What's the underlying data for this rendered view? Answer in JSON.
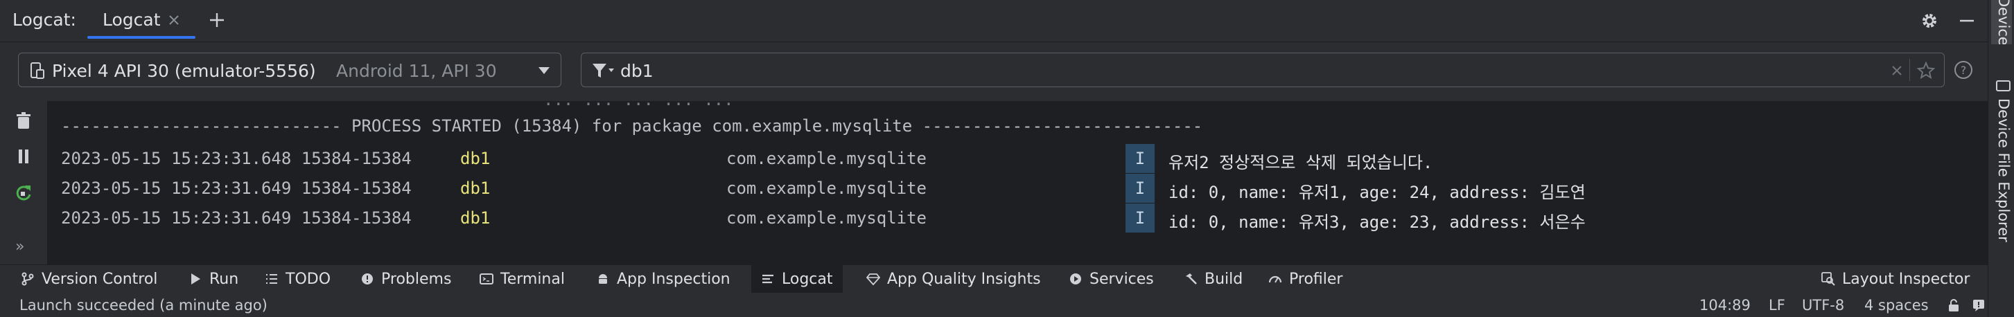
{
  "header": {
    "title": "Logcat:",
    "tab_label": "Logcat"
  },
  "right_strip": {
    "devices_label": "Devices",
    "device_file_explorer_label": "Device File Explorer"
  },
  "toolbar": {
    "device_name": "Pixel 4 API 30 (emulator-5556)",
    "device_api": "Android 11, API 30",
    "filter_value": "db1"
  },
  "log": {
    "fragment": "... ... ... ... ...",
    "process_line": "---------------------------- PROCESS STARTED (15384) for package com.example.mysqlite ----------------------------",
    "rows": [
      {
        "timestamp": "2023-05-15 15:23:31.648 15384-15384",
        "tag": "db1",
        "package": "com.example.mysqlite",
        "level": "I",
        "message": "유저2 정상적으로 삭제 되었습니다."
      },
      {
        "timestamp": "2023-05-15 15:23:31.649 15384-15384",
        "tag": "db1",
        "package": "com.example.mysqlite",
        "level": "I",
        "message": "id: 0, name: 유저1, age: 24, address: 김도연"
      },
      {
        "timestamp": "2023-05-15 15:23:31.649 15384-15384",
        "tag": "db1",
        "package": "com.example.mysqlite",
        "level": "I",
        "message": "id: 0, name: 유저3, age: 23, address: 서은수"
      }
    ]
  },
  "bottom_tabs": {
    "version_control": "Version Control",
    "run": "Run",
    "todo": "TODO",
    "problems": "Problems",
    "terminal": "Terminal",
    "app_inspection": "App Inspection",
    "logcat": "Logcat",
    "app_quality": "App Quality Insights",
    "services": "Services",
    "build": "Build",
    "profiler": "Profiler",
    "layout_inspector": "Layout Inspector"
  },
  "status": {
    "message": "Launch succeeded (a minute ago)",
    "position": "104:89",
    "line_sep": "LF",
    "encoding": "UTF-8",
    "indent": "4 spaces"
  },
  "colors": {
    "accent": "#3574f0",
    "tag": "#e8e27a",
    "info_badge": "#2a4a66",
    "restart": "#4caf50"
  }
}
